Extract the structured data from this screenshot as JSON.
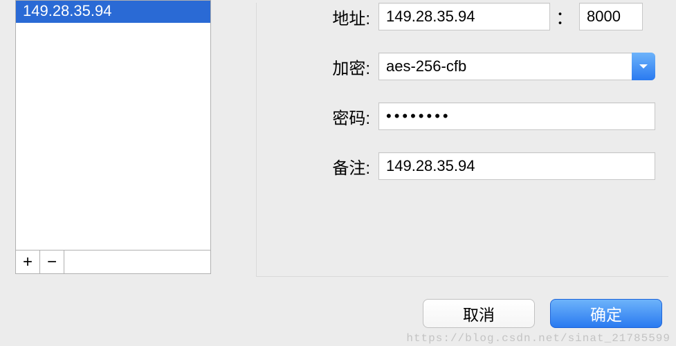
{
  "sidebar": {
    "servers": [
      {
        "label": "149.28.35.94"
      }
    ],
    "add_label": "+",
    "remove_label": "−"
  },
  "form": {
    "address_label": "地址:",
    "address_value": "149.28.35.94",
    "port_separator": "：",
    "port_value": "8000",
    "encryption_label": "加密:",
    "encryption_value": "aes-256-cfb",
    "password_label": "密码:",
    "password_value": "••••••••",
    "remark_label": "备注:",
    "remark_value": "149.28.35.94"
  },
  "buttons": {
    "cancel_label": "取消",
    "ok_label": "确定"
  },
  "watermark": "https://blog.csdn.net/sinat_21785599"
}
